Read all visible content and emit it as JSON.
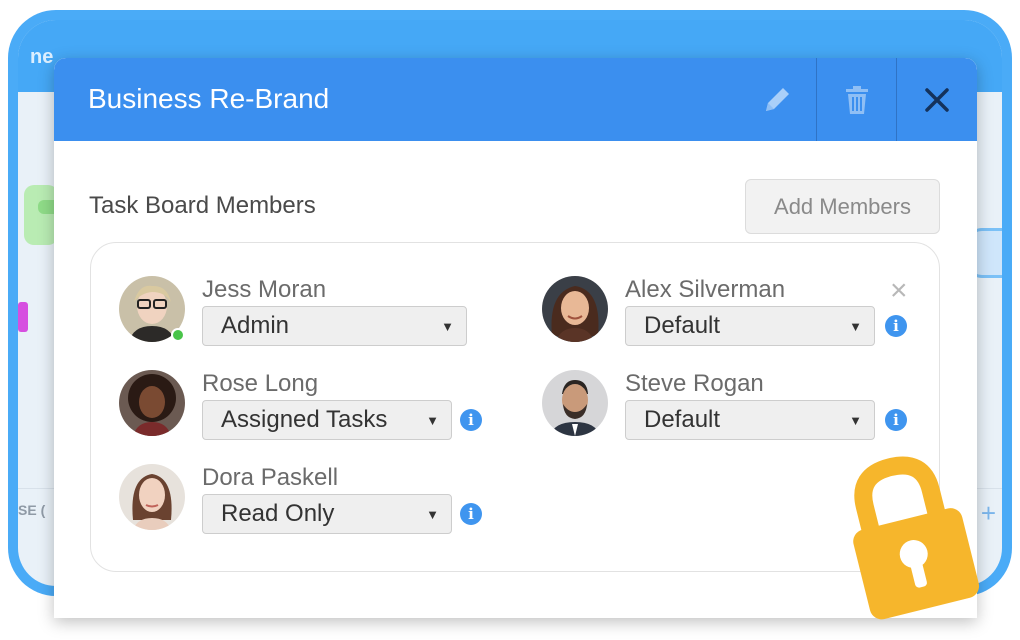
{
  "background": {
    "topbar_text": "ne",
    "side_text": "SE (",
    "plus": "+"
  },
  "modal": {
    "title": "Business Re-Brand",
    "edit_icon": "pencil-icon",
    "delete_icon": "trash-icon",
    "close_icon": "close-icon"
  },
  "section": {
    "title": "Task Board Members",
    "add_button": "Add Members"
  },
  "members": [
    {
      "name": "Jess Moran",
      "role": "Admin",
      "online": true,
      "info": false
    },
    {
      "name": "Alex Silverman",
      "role": "Default",
      "online": false,
      "info": true,
      "removable": true
    },
    {
      "name": "Rose Long",
      "role": "Assigned Tasks",
      "online": false,
      "info": true
    },
    {
      "name": "Steve Rogan",
      "role": "Default",
      "online": false,
      "info": true
    },
    {
      "name": "Dora Paskell",
      "role": "Read Only",
      "online": false,
      "info": true
    }
  ],
  "glyphs": {
    "arrow": "▼",
    "info": "i",
    "remove": "×"
  },
  "colors": {
    "header": "#3b8fef",
    "frame": "#4aabf7",
    "info": "#3f95ef",
    "online": "#49c449",
    "lock": "#f6b62c"
  },
  "lock_icon": "padlock-icon"
}
